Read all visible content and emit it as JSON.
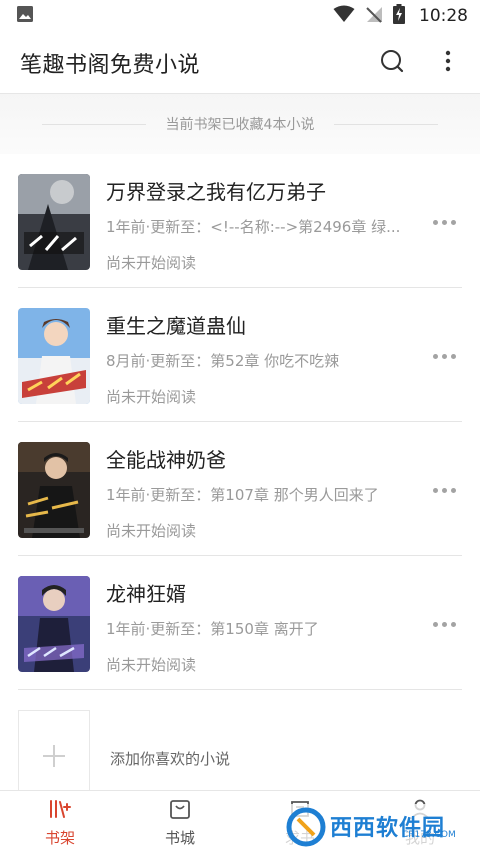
{
  "status_bar": {
    "time": "10:28"
  },
  "app_bar": {
    "title": "笔趣书阁免费小说"
  },
  "shelf": {
    "summary": "当前书架已收藏4本小说"
  },
  "books": [
    {
      "title": "万界登录之我有亿万弟子",
      "update": "1年前·更新至：<!--名称:-->第2496章 绿...",
      "progress": "尚未开始阅读",
      "cover_colors": [
        "#3a3d44",
        "#9aa0a8"
      ]
    },
    {
      "title": "重生之魔道蛊仙",
      "update": "8月前·更新至：第52章 你吃不吃辣",
      "progress": "尚未开始阅读",
      "cover_colors": [
        "#7fb4e8",
        "#c8403a"
      ]
    },
    {
      "title": "全能战神奶爸",
      "update": "1年前·更新至：第107章 那个男人回来了",
      "progress": "尚未开始阅读",
      "cover_colors": [
        "#2a2522",
        "#c79a3a"
      ]
    },
    {
      "title": "龙神狂婿",
      "update": "1年前·更新至：第150章 离开了",
      "progress": "尚未开始阅读",
      "cover_colors": [
        "#3b3f78",
        "#8a6fd0"
      ]
    }
  ],
  "add_book": {
    "label": "添加你喜欢的小说"
  },
  "bottom_nav": [
    {
      "label": "书架",
      "icon": "bookshelf-icon",
      "active": true
    },
    {
      "label": "书城",
      "icon": "bag-icon",
      "active": false
    },
    {
      "label": "求书",
      "icon": "request-icon",
      "active": false
    },
    {
      "label": "我的",
      "icon": "user-icon",
      "active": false
    }
  ],
  "colors": {
    "accent": "#d9452f",
    "text_secondary": "#9a9a9a"
  },
  "watermark": {
    "text": "西西软件园",
    "sub": "CR173.COM"
  }
}
